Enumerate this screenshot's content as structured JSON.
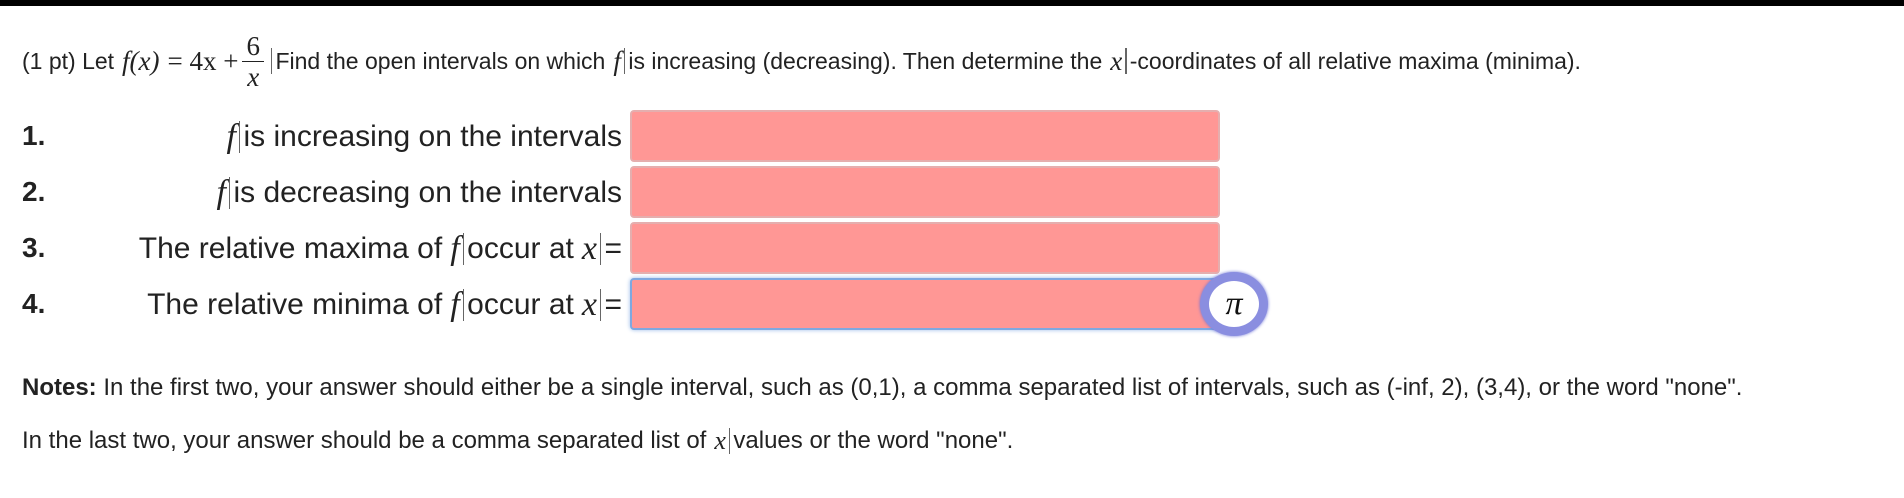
{
  "problem": {
    "prefix": "(1 pt) Let",
    "func": "f(x)",
    "equals": "= 4x +",
    "frac_num": "6",
    "frac_den": "x",
    "instructions_a": "Find the open intervals on which",
    "func_name": "f",
    "instructions_b": "is increasing (decreasing). Then determine the",
    "var": "x",
    "instructions_c": "-coordinates of all relative maxima (minima)."
  },
  "questions": [
    {
      "number": "1.",
      "pre": "",
      "f": "f",
      "post": "is increasing on the intervals",
      "var": "",
      "eq": "",
      "value": ""
    },
    {
      "number": "2.",
      "pre": "",
      "f": "f",
      "post": "is decreasing on the intervals",
      "var": "",
      "eq": "",
      "value": ""
    },
    {
      "number": "3.",
      "pre": "The relative maxima of",
      "f": "f",
      "post": "occur at",
      "var": "x",
      "eq": "=",
      "value": ""
    },
    {
      "number": "4.",
      "pre": "The relative minima of",
      "f": "f",
      "post": "occur at",
      "var": "x",
      "eq": "=",
      "value": ""
    }
  ],
  "pi_button": {
    "symbol": "π"
  },
  "notes": {
    "label": "Notes:",
    "line1": "In the first two, your answer should either be a single interval, such as (0,1), a comma separated list of intervals, such as (-inf, 2), (3,4), or the word \"none\".",
    "line2_a": "In the last two, your answer should be a comma separated list of",
    "line2_var": "x",
    "line2_b": "values or the word \"none\"."
  },
  "colors": {
    "input_bg": "#ff9795",
    "pi_ring": "#8a8ee0"
  }
}
